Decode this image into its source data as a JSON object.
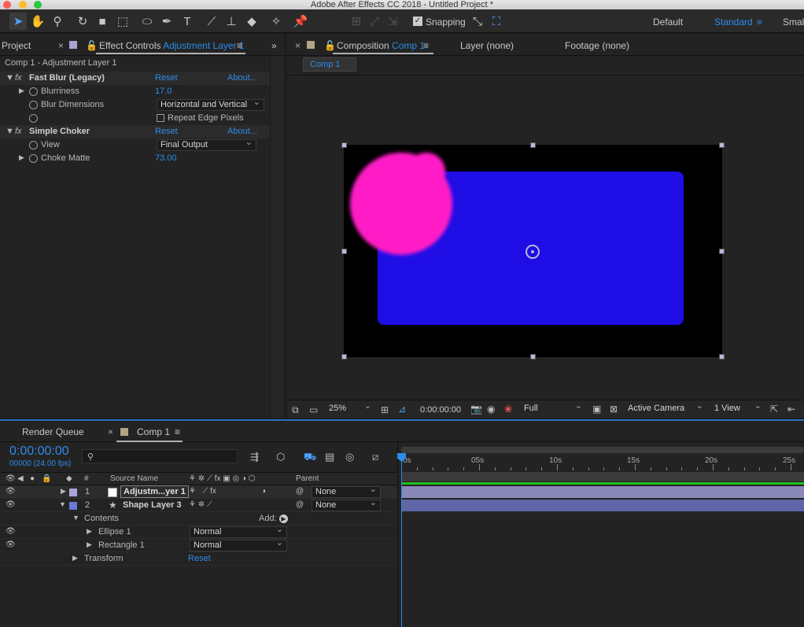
{
  "titlebar": {
    "title": "Adobe After Effects CC 2018 - Untitled Project *"
  },
  "toolbar": {
    "snapping": "Snapping",
    "workspaces": [
      "Default",
      "Standard",
      "Small"
    ]
  },
  "left_panel": {
    "tab_project": "Project",
    "tab_effect_controls": "Effect Controls",
    "tab_effect_layer": "Adjustment Layer 1",
    "header": "Comp 1 - Adjustment Layer 1",
    "effects": [
      {
        "name": "Fast Blur (Legacy)",
        "reset": "Reset",
        "about": "About...",
        "props": [
          {
            "label": "Blurriness",
            "value": "17.0"
          },
          {
            "label": "Blur Dimensions",
            "value": "Horizontal and Vertical"
          },
          {
            "label": "",
            "value": "Repeat Edge Pixels"
          }
        ]
      },
      {
        "name": "Simple Choker",
        "reset": "Reset",
        "about": "About...",
        "props": [
          {
            "label": "View",
            "value": "Final Output"
          },
          {
            "label": "Choke Matte",
            "value": "73.00"
          }
        ]
      }
    ]
  },
  "comp_panel": {
    "tab_composition": "Composition",
    "tab_comp_name": "Comp 1",
    "tab_layer": "Layer (none)",
    "tab_footage": "Footage (none)",
    "subtab": "Comp 1",
    "footer": {
      "zoom": "25%",
      "timecode": "0:00:00:00",
      "resolution": "Full",
      "camera": "Active Camera",
      "views": "1 View"
    },
    "colors": {
      "bg": "#000000",
      "rect": "#1f0de6",
      "circle": "#ff1ac6"
    }
  },
  "timeline": {
    "tab_render": "Render Queue",
    "tab_comp": "Comp 1",
    "timecode": "0:00:00:00",
    "fps": "00000 (24.00 fps)",
    "col_num": "#",
    "col_source": "Source Name",
    "col_parent": "Parent",
    "layers": [
      {
        "num": "1",
        "name": "Adjustm...yer 1",
        "parent": "None",
        "color": "#a9a3d6"
      },
      {
        "num": "2",
        "name": "Shape Layer 3",
        "parent": "None",
        "color": "#6b78d6"
      }
    ],
    "contents": "Contents",
    "add": "Add:",
    "ellipse": "Ellipse 1",
    "ellipse_mode": "Normal",
    "rectangle": "Rectangle 1",
    "rect_mode": "Normal",
    "transform": "Transform",
    "transform_reset": "Reset",
    "ruler": [
      "0s",
      "05s",
      "10s",
      "15s",
      "20s",
      "25s"
    ]
  }
}
